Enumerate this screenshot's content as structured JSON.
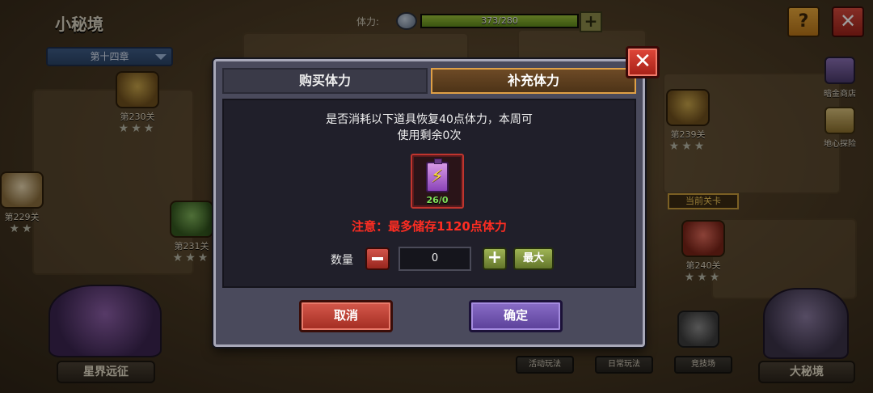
{
  "header": {
    "title": "小秘境",
    "chapter": "第十四章",
    "stamina_label": "体力:",
    "stamina_value": "373/280",
    "stamina_fill_fraction": 1.0,
    "help_icon": "?",
    "close_icon": "✕"
  },
  "map": {
    "levels": [
      {
        "label": "第230关",
        "stars": "★★★"
      },
      {
        "label": "第229关",
        "stars": "★★"
      },
      {
        "label": "第231关",
        "stars": "★★★"
      },
      {
        "label": "第239关",
        "stars": "★★★"
      },
      {
        "label": "第240关",
        "stars": "★★★"
      }
    ],
    "current_badge": "当前关卡"
  },
  "side_menu": {
    "shop_label": "暗金商店",
    "explore_label": "地心探险"
  },
  "bottom": {
    "left_plate": "星界远征",
    "activity": "活动玩法",
    "daily": "日常玩法",
    "arena": "竞技场",
    "right_plate": "大秘境"
  },
  "dialog": {
    "tab_buy": "购买体力",
    "tab_refill": "补充体力",
    "active_tab": "补充体力",
    "message_line1": "是否消耗以下道具恢复40点体力，本周可",
    "message_line2": "使用剩余0次",
    "item_count": "26/0",
    "item_icon": "⚡",
    "warning": "注意：最多储存1120点体力",
    "quantity_label": "数量",
    "quantity_value": "0",
    "plus_label": "+",
    "max_label": "最大",
    "cancel_label": "取消",
    "confirm_label": "确定",
    "close_icon": "✕"
  },
  "colors": {
    "warning_text": "#ff2d22",
    "active_tab_border": "#e0a046",
    "item_count_green": "#7ee05a",
    "cancel_button": "#b8342a",
    "confirm_button": "#6a4fb0"
  }
}
